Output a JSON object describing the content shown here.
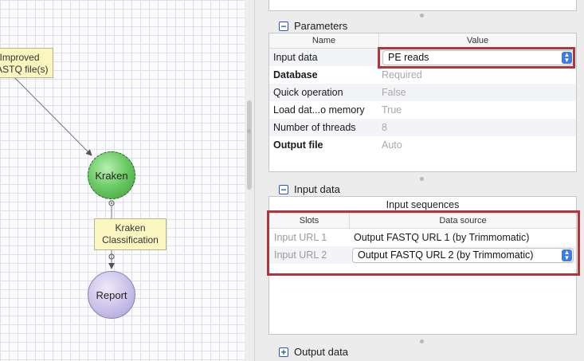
{
  "canvas": {
    "notes": {
      "improved": "Improved\nFASTQ file(s)",
      "classification": "Kraken\nClassification"
    },
    "nodes": {
      "kraken": "Kraken",
      "report": "Report"
    }
  },
  "parameters": {
    "title": "Parameters",
    "toggle": "−",
    "columns": {
      "name": "Name",
      "value": "Value"
    },
    "rows": [
      {
        "name": "Input data",
        "value": "PE reads",
        "bold": false
      },
      {
        "name": "Database",
        "value": "Required",
        "bold": true
      },
      {
        "name": "Quick operation",
        "value": "False",
        "bold": false
      },
      {
        "name": "Load dat...o memory",
        "value": "True",
        "bold": false
      },
      {
        "name": "Number of threads",
        "value": "8",
        "bold": false
      },
      {
        "name": "Output file",
        "value": "Auto",
        "bold": true
      }
    ]
  },
  "input_data": {
    "title": "Input data",
    "toggle": "−",
    "caption": "Input sequences",
    "columns": {
      "slots": "Slots",
      "source": "Data source"
    },
    "rows": [
      {
        "slot": "Input URL 1",
        "source": "Output FASTQ URL 1 (by Trimmomatic)"
      },
      {
        "slot": "Input URL 2",
        "source": "Output FASTQ URL 2 (by Trimmomatic)"
      }
    ]
  },
  "output_data": {
    "title": "Output data",
    "toggle": "+"
  },
  "colors": {
    "highlight": "#b3343a",
    "accent": "#3a7be8"
  }
}
